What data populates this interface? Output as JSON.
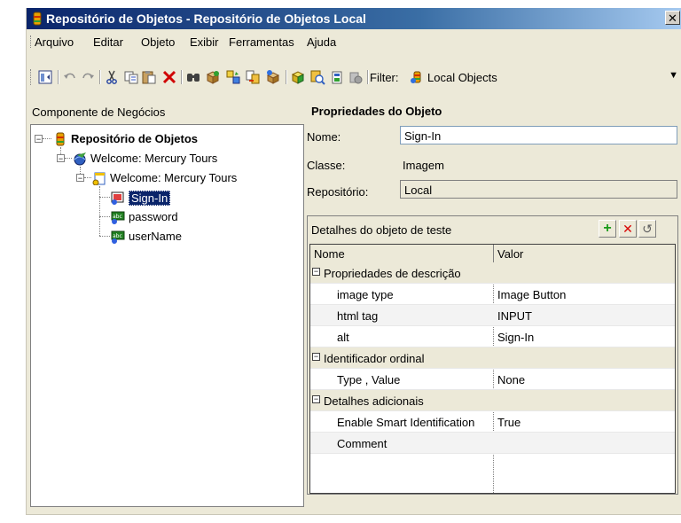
{
  "window": {
    "title": "Repositório de Objetos - Repositório de Objetos Local",
    "close_glyph": "✕"
  },
  "menubar": {
    "items": [
      "Arquivo",
      "Editar",
      "Objeto",
      "Exibir",
      "Ferramentas",
      "Ajuda"
    ]
  },
  "toolbar": {
    "icons": [
      "show-tree-icon",
      "undo-icon",
      "redo-icon",
      "cut-icon",
      "copy-icon",
      "paste-icon",
      "delete-icon",
      "find-icon",
      "add-objects-icon",
      "update-from-app-icon",
      "merge-icon",
      "export-icon",
      "highlight-icon",
      "locate-icon",
      "object-spy-icon",
      "checkpoint-icon"
    ],
    "filter_label": "Filter:",
    "filter_value": "Local Objects"
  },
  "tree": {
    "label": "Componente de Negócios",
    "nodes": [
      {
        "text": "Repositório de Objetos",
        "icon": "repository-icon",
        "bold": true
      },
      {
        "text": "Welcome: Mercury Tours",
        "icon": "browser-icon"
      },
      {
        "text": "Welcome: Mercury Tours",
        "icon": "page-icon"
      },
      {
        "text": "Sign-In",
        "icon": "image-icon",
        "selected": true
      },
      {
        "text": "password",
        "icon": "edit-field-icon"
      },
      {
        "text": "userName",
        "icon": "edit-field-icon"
      }
    ]
  },
  "properties": {
    "title": "Propriedades do Objeto",
    "name_label": "Nome:",
    "name_value": "Sign-In",
    "class_label": "Classe:",
    "class_value": "Imagem",
    "repo_label": "Repositório:",
    "repo_value": "Local"
  },
  "details": {
    "title": "Detalhes do objeto de teste",
    "add_glyph": "+",
    "remove_glyph": "✕",
    "refresh_glyph": "↺",
    "col_name": "Nome",
    "col_value": "Valor",
    "rows": [
      {
        "group": true,
        "name": "Propriedades de descrição",
        "value": ""
      },
      {
        "name": "image type",
        "value": "Image Button"
      },
      {
        "name": "html tag",
        "value": "INPUT"
      },
      {
        "name": "alt",
        "value": "Sign-In"
      },
      {
        "group": true,
        "name": "Identificador ordinal",
        "value": ""
      },
      {
        "name": "Type , Value",
        "value": "None"
      },
      {
        "group": true,
        "name": "Detalhes adicionais",
        "value": ""
      },
      {
        "name": "Enable Smart Identification",
        "value": "True"
      },
      {
        "name": "Comment",
        "value": ""
      }
    ]
  },
  "colors": {
    "title_gradient_start": "#0a246a",
    "title_gradient_end": "#a6caf0",
    "selection": "#0a246a",
    "add_green": "#1a9a1a",
    "remove_red": "#d80000"
  }
}
